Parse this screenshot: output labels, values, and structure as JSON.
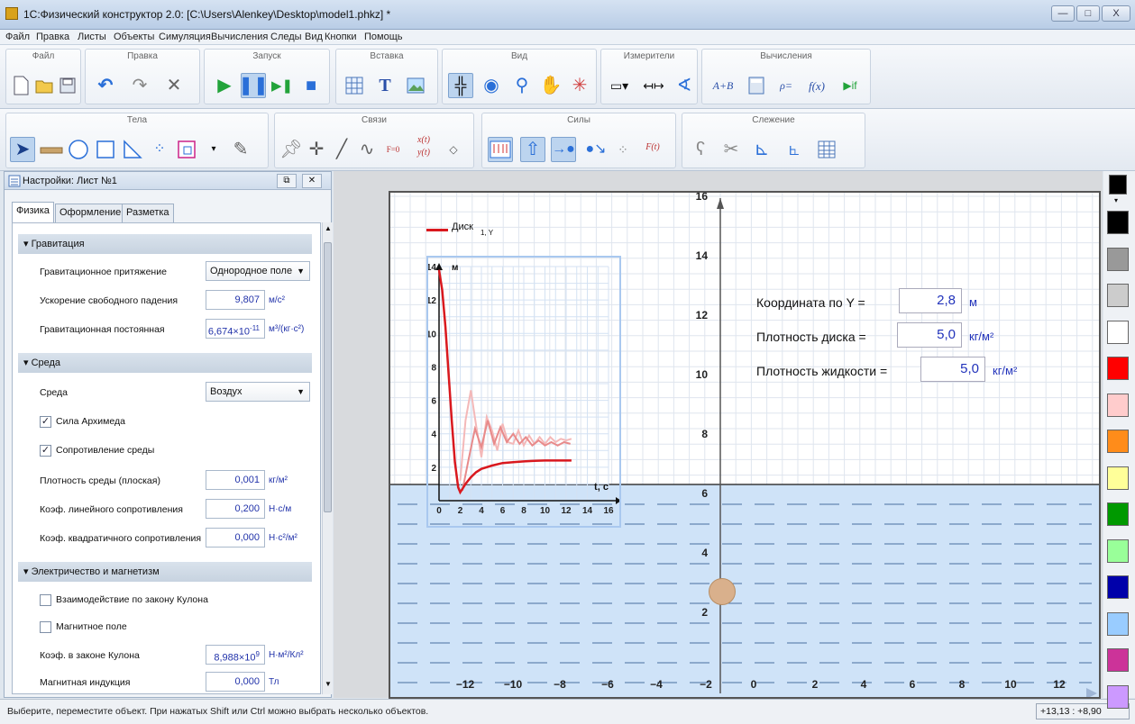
{
  "window": {
    "title": "1С:Физический конструктор 2.0: [C:\\Users\\Alenkey\\Desktop\\model1.phkz] *",
    "btn_minimize": "—",
    "btn_maximize": "□",
    "btn_close": "X"
  },
  "menu": [
    "Файл",
    "Правка",
    "Листы",
    "Объекты",
    "Симуляция",
    "Вычисления",
    "Следы",
    "Вид",
    "Кнопки",
    "Помощь"
  ],
  "toolbar_groups_top": [
    "Файл",
    "Правка",
    "Запуск",
    "Вставка",
    "Вид",
    "Измерители",
    "Вычисления"
  ],
  "toolbar_groups_bottom": [
    "Тела",
    "Связи",
    "Силы",
    "Слежение"
  ],
  "toolbar_text": {
    "sum": "A+B",
    "rho": "ρ=",
    "fx": "f(x)",
    "iff": "▶if",
    "f0": "F=0",
    "xt": "x(t)",
    "yt": "y(t)",
    "ft": "F(t)"
  },
  "panel": {
    "title": "Настройки: Лист №1",
    "tabs": [
      "Физика",
      "Оформление",
      "Разметка"
    ],
    "gravitation": {
      "header": "Гравитация",
      "attraction_label": "Гравитационное притяжение",
      "attraction_value": "Однородное поле",
      "g_label": "Ускорение свободного падения",
      "g_value": "9,807",
      "g_unit": "м/с²",
      "G_label": "Гравитационная постоянная",
      "G_value_base": "6,674×10",
      "G_value_exp": "-11",
      "G_unit": "м³/(кг·с²)"
    },
    "medium": {
      "header": "Среда",
      "medium_label": "Среда",
      "medium_value": "Воздух",
      "archimedes_label": "Сила Архимеда",
      "archimedes_checked": true,
      "resistance_label": "Сопротивление среды",
      "resistance_checked": true,
      "density_label": "Плотность среды (плоская)",
      "density_value": "0,001",
      "density_unit": "кг/м²",
      "linear_label": "Коэф. линейного сопротивления",
      "linear_value": "0,200",
      "linear_unit": "Н·с/м",
      "quad_label": "Коэф. квадратичного сопротивления",
      "quad_value": "0,000",
      "quad_unit": "Н·с²/м²"
    },
    "em": {
      "header": "Электричество и магнетизм",
      "coulomb_label": "Взаимодействие по закону Кулона",
      "coulomb_checked": false,
      "magnetic_label": "Магнитное поле",
      "magnetic_checked": false,
      "k_label": "Коэф. в законе Кулона",
      "k_value_base": "8,988×10",
      "k_value_exp": "9",
      "k_unit": "Н·м²/Кл²",
      "b_label": "Магнитная индукция",
      "b_value": "0,000",
      "b_unit": "Тл"
    }
  },
  "sheet": {
    "x_ticks": [
      "−12",
      "−10",
      "−8",
      "−6",
      "−4",
      "−2",
      "0",
      "2",
      "4",
      "6",
      "8",
      "10",
      "12"
    ],
    "y_ticks": [
      "16",
      "14",
      "12",
      "10",
      "8",
      "6",
      "4",
      "2"
    ],
    "readouts": [
      {
        "label": "Координата по Y  =",
        "value": "2,8",
        "unit": "м"
      },
      {
        "label": "Плотность диска  =",
        "value": "5,0",
        "unit": "кг/м²"
      },
      {
        "label": "Плотность жидкости  =",
        "value": "5,0",
        "unit": "кг/м²"
      }
    ],
    "liquid_color": "#cfe3f8",
    "disk_color": "#d9b08c"
  },
  "chart_data": {
    "type": "line",
    "legend": "Диск",
    "legend_sub": "1, Y",
    "xlabel": "t, c",
    "ylabel": "м",
    "xlim": [
      0,
      16
    ],
    "ylim": [
      0,
      14
    ],
    "x_tick_labels": [
      "0",
      "2",
      "4",
      "6",
      "8",
      "10",
      "12",
      "14",
      "16"
    ],
    "y_tick_labels": [
      "2",
      "4",
      "6",
      "8",
      "10",
      "12",
      "14"
    ],
    "series": [
      {
        "color": "#d9181e",
        "x": [
          0,
          0.3,
          0.6,
          0.9,
          1.2,
          1.5,
          1.8,
          2.0,
          2.2,
          2.5,
          3,
          3.5,
          4,
          5,
          6,
          7,
          8,
          9,
          10,
          11,
          12,
          12.5
        ],
        "y": [
          13.8,
          12.6,
          10.4,
          7.6,
          4.8,
          2.3,
          0.8,
          0.5,
          0.7,
          1.0,
          1.4,
          1.7,
          1.9,
          2.1,
          2.25,
          2.3,
          2.35,
          2.38,
          2.4,
          2.4,
          2.4,
          2.4
        ]
      },
      {
        "color": "#e88a8a",
        "x": [
          2.2,
          2.8,
          3.4,
          4.0,
          4.6,
          5.2,
          5.8,
          6.4,
          7.0,
          7.6,
          8.2,
          8.8,
          9.4,
          10.0,
          10.6,
          11.2,
          11.8,
          12.4
        ],
        "y": [
          0.6,
          2.5,
          4.3,
          3.2,
          4.8,
          3.4,
          4.4,
          3.5,
          4.0,
          3.4,
          3.8,
          3.3,
          3.6,
          3.3,
          3.5,
          3.3,
          3.5,
          3.4
        ]
      },
      {
        "color": "#f4b8b8",
        "x": [
          2.0,
          2.5,
          3.0,
          3.5,
          4.0,
          4.5,
          5.0,
          5.5,
          6.0,
          6.5,
          7.0,
          7.5,
          8.0,
          8.5,
          9.0,
          9.5,
          10.0,
          10.5,
          11.0,
          11.5,
          12.0,
          12.5
        ],
        "y": [
          1.2,
          4.8,
          6.6,
          4.5,
          2.6,
          5.0,
          4.2,
          3.0,
          4.6,
          3.5,
          3.4,
          4.2,
          3.3,
          3.9,
          3.4,
          3.8,
          3.4,
          3.8,
          3.5,
          3.7,
          3.6,
          3.7
        ]
      }
    ]
  },
  "palette": [
    "#000000",
    "#000000",
    "#999999",
    "#cccccc",
    "#ffffff",
    "#ff0000",
    "#ffcccc",
    "#ff8c1a",
    "#ffff99",
    "#009900",
    "#99ff99",
    "#0000aa",
    "#99ccff",
    "#cc3399",
    "#cc99ff"
  ],
  "status": {
    "text": "Выберите, переместите объект. При нажатых Shift или Ctrl можно выбрать несколько объектов.",
    "coords": "+13,13 : +8,90"
  }
}
